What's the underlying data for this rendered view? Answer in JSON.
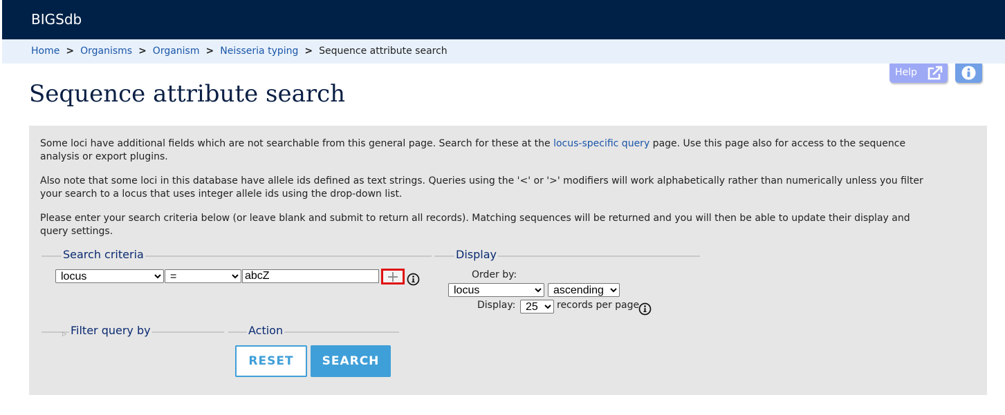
{
  "header": {
    "site_title": "BIGSdb"
  },
  "breadcrumb": {
    "items": [
      "Home",
      "Organisms",
      "Organism",
      "Neisseria typing"
    ],
    "current": "Sequence attribute search",
    "separator": ">"
  },
  "top_buttons": {
    "help_label": "Help"
  },
  "page": {
    "title": "Sequence attribute search"
  },
  "intro": {
    "p1_before": "Some loci have additional fields which are not searchable from this general page. Search for these at the ",
    "p1_link": "locus-specific query",
    "p1_after": " page. Use this page also for access to the sequence analysis or export plugins.",
    "p2": "Also note that some loci in this database have allele ids defined as text strings. Queries using the '<' or '>' modifiers will work alphabetically rather than numerically unless you filter your search to a locus that uses integer allele ids using the drop-down list.",
    "p3": "Please enter your search criteria below (or leave blank and submit to return all records). Matching sequences will be returned and you will then be able to update their display and query settings."
  },
  "search_criteria": {
    "legend": "Search criteria",
    "field_value": "locus",
    "operator_value": "=",
    "term_value": "abcZ",
    "add_label": "+"
  },
  "display": {
    "legend": "Display",
    "order_by_label": "Order by:",
    "order_field_value": "locus",
    "order_direction_value": "ascending",
    "display_label": "Display:",
    "records_value": "25",
    "records_suffix": "records per page"
  },
  "filter": {
    "legend": "Filter query by"
  },
  "action": {
    "legend": "Action",
    "reset_label": "RESET",
    "search_label": "SEARCH"
  },
  "colors": {
    "header_bg": "#002147",
    "breadcrumb_bg": "#e8f1fb",
    "link": "#1a55a8",
    "panel_bg": "#e6e6e6",
    "accent": "#3f9fd8",
    "highlight": "#e01010"
  }
}
